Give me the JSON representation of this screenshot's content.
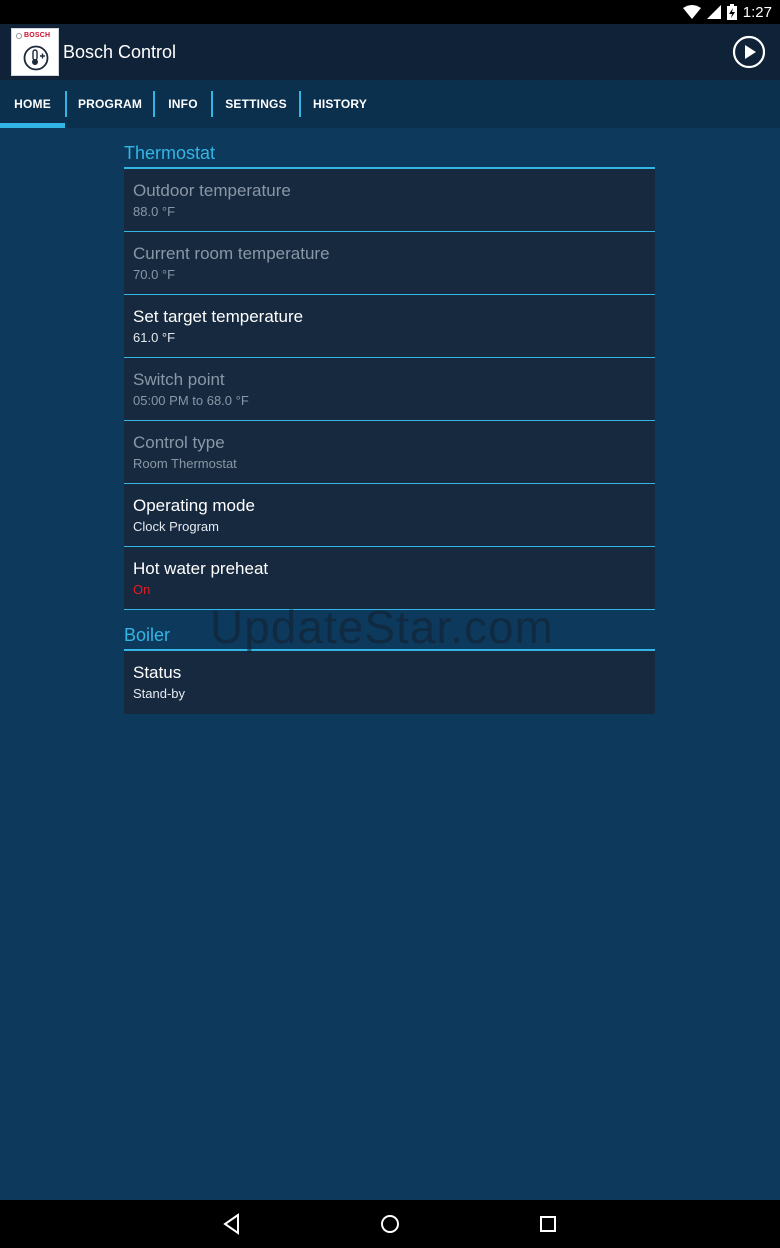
{
  "status_bar": {
    "time": "1:27"
  },
  "app_bar": {
    "brand": "BOSCH",
    "title": "Bosch Control"
  },
  "tabs": [
    {
      "label": "HOME",
      "active": true
    },
    {
      "label": "PROGRAM",
      "active": false
    },
    {
      "label": "INFO",
      "active": false
    },
    {
      "label": "SETTINGS",
      "active": false
    },
    {
      "label": "HISTORY",
      "active": false
    }
  ],
  "thermostat": {
    "header": "Thermostat",
    "items": [
      {
        "label": "Outdoor temperature",
        "value": "88.0 °F",
        "enabled": false
      },
      {
        "label": "Current room temperature",
        "value": "70.0 °F",
        "enabled": false
      },
      {
        "label": "Set target temperature",
        "value": "61.0 °F",
        "enabled": true
      },
      {
        "label": "Switch point",
        "value": "05:00 PM to 68.0 °F",
        "enabled": false
      },
      {
        "label": "Control type",
        "value": "Room Thermostat",
        "enabled": false
      },
      {
        "label": "Operating mode",
        "value": "Clock Program",
        "enabled": true
      },
      {
        "label": "Hot water preheat",
        "value": "On",
        "enabled": true,
        "value_color": "#e51c23"
      }
    ]
  },
  "boiler": {
    "header": "Boiler",
    "items": [
      {
        "label": "Status",
        "value": "Stand-by",
        "enabled": true
      }
    ]
  },
  "watermark": "UpdateStar.com",
  "colors": {
    "accent": "#33b5e5",
    "background": "#0d3a5c",
    "item_bg": "#16293f",
    "alert": "#e51c23"
  },
  "icons": {
    "status": [
      "wifi-icon",
      "cell-signal-icon",
      "battery-charging-icon"
    ],
    "app_bar": [
      "bosch-thermostat-logo-icon",
      "play-icon"
    ],
    "nav": [
      "back-icon",
      "home-icon",
      "recents-icon"
    ]
  }
}
